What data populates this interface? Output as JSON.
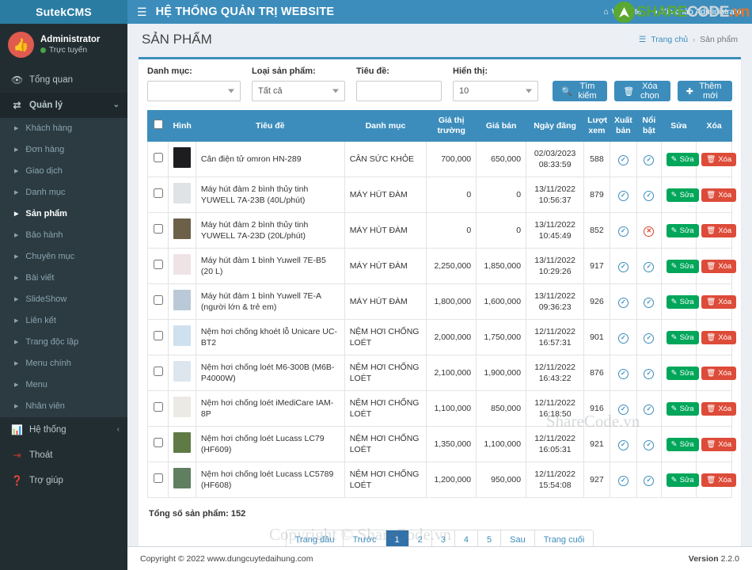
{
  "brand": {
    "name": "SutekCMS"
  },
  "user": {
    "name": "Administrator",
    "status": "Trực tuyến"
  },
  "topbar": {
    "system_title": "HỆ THỐNG QUẢN TRỊ WEBSITE",
    "website_link": "Website",
    "greeting": "Xin chào Administrator"
  },
  "sidebar": {
    "items": [
      {
        "label": "Tổng quan",
        "icon": "eye-icon"
      },
      {
        "label": "Quản lý",
        "icon": "exchange-icon",
        "active": true,
        "caret": "⌄"
      },
      {
        "label": "Hệ thống",
        "icon": "bars-chart-icon",
        "caret": "‹"
      },
      {
        "label": "Thoát",
        "icon": "logout-icon"
      },
      {
        "label": "Trợ giúp",
        "icon": "help-icon"
      }
    ],
    "submenu": [
      "Khách hàng",
      "Đơn hàng",
      "Giao dịch",
      "Danh mục",
      "Sản phẩm",
      "Bảo hành",
      "Chuyên mục",
      "Bài viết",
      "SlideShow",
      "Liên kết",
      "Trang độc lập",
      "Menu chính",
      "Menu",
      "Nhân viên"
    ],
    "selected_submenu": "Sản phẩm"
  },
  "page": {
    "title": "SẢN PHẨM",
    "breadcrumb_home": "Trang chủ",
    "breadcrumb_sep": "›",
    "breadcrumb_current": "Sản phẩm"
  },
  "filters": {
    "category_label": "Danh mục:",
    "category_value": "",
    "type_label": "Loại sản phẩm:",
    "type_value": "Tất cả",
    "title_label": "Tiêu đề:",
    "title_value": "",
    "show_label": "Hiển thị:",
    "show_value": "10",
    "search_button": "Tìm kiếm",
    "clear_button": "Xóa chọn",
    "add_button": "Thêm mới"
  },
  "table": {
    "headers": {
      "image": "Hình",
      "title": "Tiêu đề",
      "category": "Danh mục",
      "market_price": "Giá thị trường",
      "sale_price": "Giá bán",
      "date": "Ngày đăng",
      "views": "Lượt xem",
      "published": "Xuất bản",
      "featured": "Nổi bật",
      "edit": "Sửa",
      "delete": "Xóa"
    },
    "edit_label": "Sửa",
    "delete_label": "Xóa",
    "rows": [
      {
        "title": "Cân điện tử omron HN-289",
        "category": "CÂN SỨC KHỎE",
        "market_price": "700,000",
        "sale_price": "650,000",
        "date": "02/03/2023",
        "time": "08:33:59",
        "views": "588",
        "published": true,
        "featured": true,
        "thumb": "#1d1d20"
      },
      {
        "title": "Máy hút đàm 2 bình thủy tinh YUWELL 7A-23B (40L/phút)",
        "category": "MÁY HÚT ĐÀM",
        "market_price": "0",
        "sale_price": "0",
        "date": "13/11/2022",
        "time": "10:56:37",
        "views": "879",
        "published": true,
        "featured": true,
        "thumb": "#dfe3e6"
      },
      {
        "title": "Máy hút đàm 2 bình thủy tinh YUWELL 7A-23D (20L/phút)",
        "category": "MÁY HÚT ĐÀM",
        "market_price": "0",
        "sale_price": "0",
        "date": "13/11/2022",
        "time": "10:45:49",
        "views": "852",
        "published": true,
        "featured": false,
        "thumb": "#6d6049"
      },
      {
        "title": "Máy hút đàm 1 bình Yuwell 7E-B5 (20 L)",
        "category": "MÁY HÚT ĐÀM",
        "market_price": "2,250,000",
        "sale_price": "1,850,000",
        "date": "13/11/2022",
        "time": "10:29:26",
        "views": "917",
        "published": true,
        "featured": true,
        "thumb": "#f0e3e6"
      },
      {
        "title": "Máy hút đàm 1 bình Yuwell 7E-A (người lớn & trẻ em)",
        "category": "MÁY HÚT ĐÀM",
        "market_price": "1,800,000",
        "sale_price": "1,600,000",
        "date": "13/11/2022",
        "time": "09:36:23",
        "views": "926",
        "published": true,
        "featured": true,
        "thumb": "#b9c9d8"
      },
      {
        "title": "Nệm hơi chống khoét lỗ Unicare UC-BT2",
        "category": "NỆM HƠI CHỐNG LOÉT",
        "market_price": "2,000,000",
        "sale_price": "1,750,000",
        "date": "12/11/2022",
        "time": "16:57:31",
        "views": "901",
        "published": true,
        "featured": true,
        "thumb": "#cfe0ee"
      },
      {
        "title": "Nệm hơi chống loét M6-300B (M6B-P4000W)",
        "category": "NỆM HƠI CHỐNG LOÉT",
        "market_price": "2,100,000",
        "sale_price": "1,900,000",
        "date": "12/11/2022",
        "time": "16:43:22",
        "views": "876",
        "published": true,
        "featured": true,
        "thumb": "#dde6ee"
      },
      {
        "title": "Nệm hơi chống loét iMediCare IAM-8P",
        "category": "NỆM HƠI CHỐNG LOÉT",
        "market_price": "1,100,000",
        "sale_price": "850,000",
        "date": "12/11/2022",
        "time": "16:18:50",
        "views": "916",
        "published": true,
        "featured": true,
        "thumb": "#eceae4"
      },
      {
        "title": "Nệm hơi chống loét Lucass LC79 (HF609)",
        "category": "NỆM HƠI CHỐNG LOÉT",
        "market_price": "1,350,000",
        "sale_price": "1,100,000",
        "date": "12/11/2022",
        "time": "16:05:31",
        "views": "921",
        "published": true,
        "featured": true,
        "thumb": "#5f7a45"
      },
      {
        "title": "Nệm hơi chống loét Lucass LC5789 (HF608)",
        "category": "NỆM HƠI CHỐNG LOÉT",
        "market_price": "1,200,000",
        "sale_price": "950,000",
        "date": "12/11/2022",
        "time": "15:54:08",
        "views": "927",
        "published": true,
        "featured": true,
        "thumb": "#5f7f60"
      }
    ]
  },
  "summary": {
    "total_text": "Tổng số sản phẩm: 152"
  },
  "pagination": {
    "items": [
      "Trang đầu",
      "Trước",
      "1",
      "2",
      "3",
      "4",
      "5",
      "Sau",
      "Trang cuối"
    ],
    "active": "1"
  },
  "footer": {
    "copyright": "Copyright © 2022 www.dungcuytedaihung.com",
    "version_label": "Version",
    "version_value": "2.2.0"
  },
  "watermark": {
    "logo_a": "SHARE",
    "logo_b": "CODE",
    "logo_c": ".vn",
    "mid": "ShareCode.vn",
    "footer": "Copyright © ShareCode.vn"
  },
  "colors": {
    "primary": "#3c8dbc",
    "sidebar": "#222d32",
    "submenu": "#2c3b41",
    "success": "#00a65a",
    "danger": "#dd4b39",
    "online": "#47a447"
  }
}
